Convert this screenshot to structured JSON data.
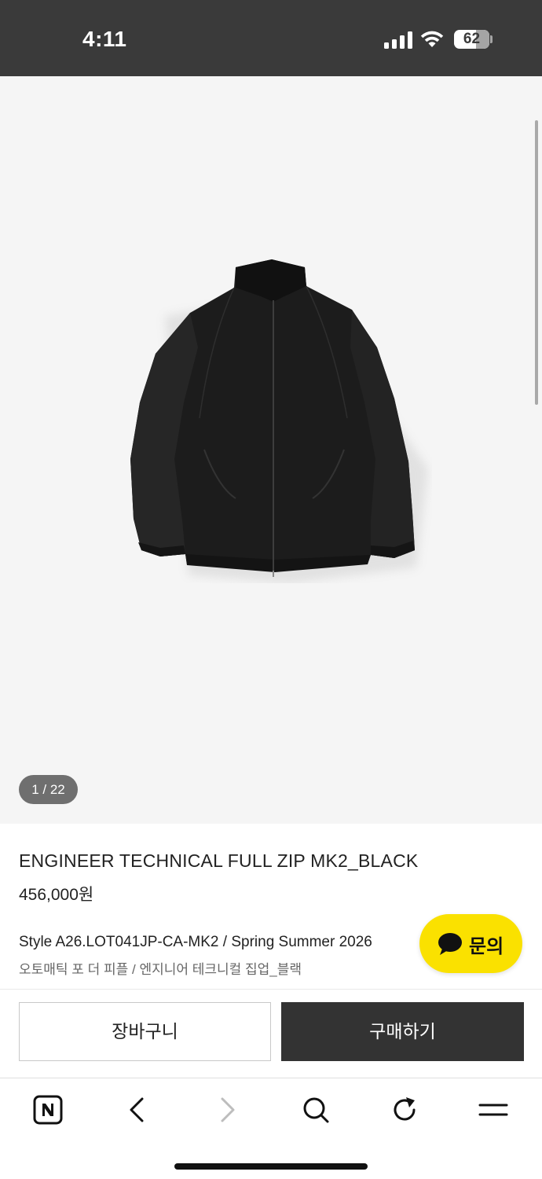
{
  "status_bar": {
    "time": "4:11",
    "battery": "62",
    "battery_level": 0.62
  },
  "gallery": {
    "page_indicator": "1 / 22",
    "image_alt": "black full zip jacket"
  },
  "product": {
    "name": "ENGINEER TECHNICAL FULL ZIP MK2_BLACK",
    "price": "456,000원",
    "style": "Style A26.LOT041JP-CA-MK2 / Spring Summer 2026",
    "description": "오토매틱 포 더 피플 / 엔지니어 테크니컬 집업_블랙"
  },
  "inquiry": {
    "label": "문의",
    "color": "#fae100"
  },
  "actions": {
    "cart_label": "장바구니",
    "buy_label": "구매하기"
  },
  "toolbar": {
    "icons": [
      "naver-n-icon",
      "back-arrow-icon",
      "forward-arrow-icon",
      "search-icon",
      "refresh-icon",
      "menu-icon"
    ]
  }
}
